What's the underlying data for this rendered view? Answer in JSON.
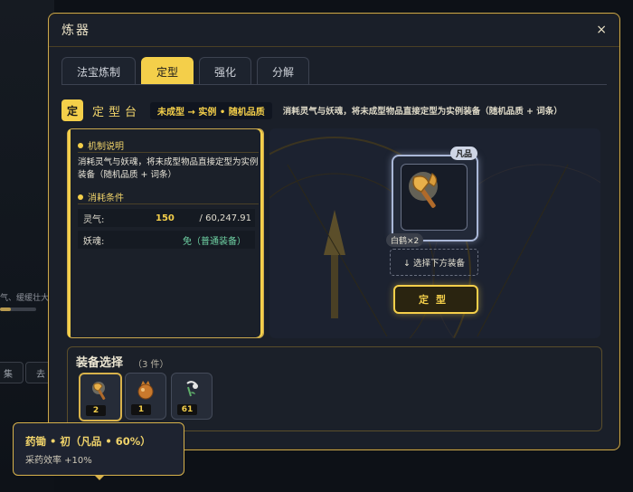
{
  "background": {
    "fragment_text": "气、缓缓壮大",
    "buttons": [
      "集",
      "去"
    ]
  },
  "window": {
    "title": "炼器",
    "close_label": "×"
  },
  "tabs": [
    {
      "label": "法宝炼制",
      "active": false
    },
    {
      "label": "定型",
      "active": true
    },
    {
      "label": "强化",
      "active": false
    },
    {
      "label": "分解",
      "active": false
    }
  ],
  "heading": {
    "badge": "定",
    "title": "定型台",
    "flow": "未成型 → 实例 • 随机品质",
    "description": "消耗灵气与妖魂，将未成型物品直接定型为实例装备（随机品质 + 词条）"
  },
  "info": {
    "mechanism_title": "机制说明",
    "mechanism_text": "消耗灵气与妖魂，将未成型物品直接定型为实例装备（随机品质 + 词条）",
    "cost_title": "消耗条件",
    "costs": [
      {
        "label": "灵气:",
        "required": "150",
        "owned": "/ 60,247.91"
      },
      {
        "label": "妖魂:",
        "note": "免（普通装备）"
      }
    ]
  },
  "stage": {
    "rarity_tag": "凡品",
    "quantity_tag": "白鹤×2",
    "item_icon": "axe-icon",
    "select_hint": "↓ 选择下方装备",
    "confirm_label": "定型"
  },
  "equipment": {
    "title": "装备选择",
    "count": "（3 件）",
    "slots": [
      {
        "icon": "hoe-icon",
        "count": "2",
        "selected": true
      },
      {
        "icon": "fruit-icon",
        "count": "1",
        "selected": false
      },
      {
        "icon": "herb-icon",
        "count": "61",
        "selected": false
      }
    ]
  },
  "tooltip": {
    "name": "药锄 • 初（凡品 • 60%）",
    "effect": "采药效率 +10%"
  },
  "colors": {
    "accent": "#f4cf4a",
    "window_border": "#c9a74d",
    "free_text": "#6fd3a4"
  }
}
